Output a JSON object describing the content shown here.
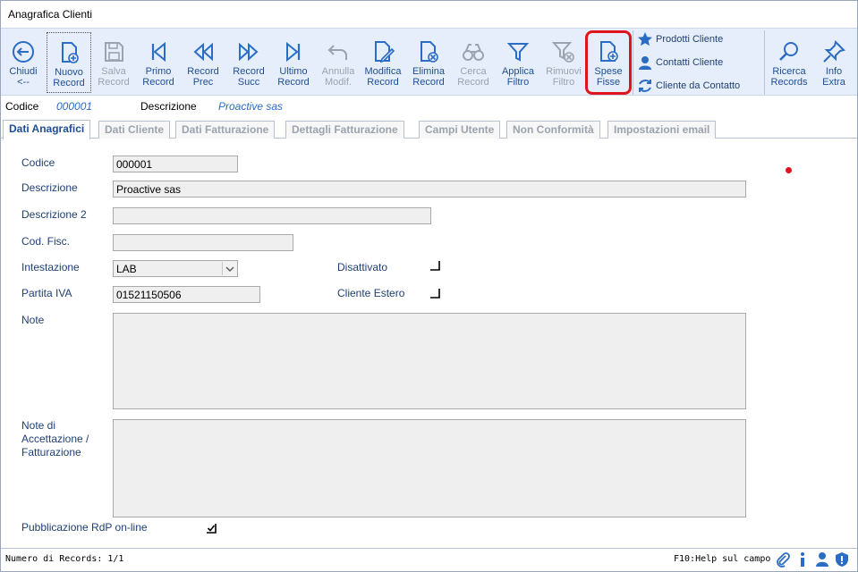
{
  "window": {
    "title": "Anagrafica Clienti"
  },
  "toolbar": {
    "buttons": [
      {
        "id": "chiudi",
        "label": "Chiudi\n<--",
        "icon": "back-arrow-icon",
        "enabled": true
      },
      {
        "id": "nuovo",
        "label": "Nuovo\nRecord",
        "icon": "new-document-icon",
        "enabled": true
      },
      {
        "id": "salva",
        "label": "Salva\nRecord",
        "icon": "floppy-icon",
        "enabled": false
      },
      {
        "id": "primo",
        "label": "Primo\nRecord",
        "icon": "first-record-icon",
        "enabled": true
      },
      {
        "id": "prec",
        "label": "Record\nPrec",
        "icon": "previous-record-icon",
        "enabled": true
      },
      {
        "id": "succ",
        "label": "Record\nSucc",
        "icon": "next-record-icon",
        "enabled": true
      },
      {
        "id": "ultimo",
        "label": "Ultimo\nRecord",
        "icon": "last-record-icon",
        "enabled": true
      },
      {
        "id": "annulla",
        "label": "Annulla\nModif.",
        "icon": "undo-icon",
        "enabled": false
      },
      {
        "id": "modifica",
        "label": "Modifica\nRecord",
        "icon": "edit-document-icon",
        "enabled": true
      },
      {
        "id": "elimina",
        "label": "Elimina\nRecord",
        "icon": "delete-document-icon",
        "enabled": true
      },
      {
        "id": "cerca",
        "label": "Cerca\nRecord",
        "icon": "binoculars-icon",
        "enabled": false
      },
      {
        "id": "applica",
        "label": "Applica\nFiltro",
        "icon": "filter-icon",
        "enabled": true
      },
      {
        "id": "rimuovi",
        "label": "Rimuovi\nFiltro",
        "icon": "remove-filter-icon",
        "enabled": false
      },
      {
        "id": "spese",
        "label": "Spese\nFisse",
        "icon": "add-document-icon",
        "enabled": true
      }
    ],
    "side_links": [
      {
        "label": "Prodotti Cliente",
        "icon": "star-icon"
      },
      {
        "label": "Contatti Cliente",
        "icon": "contact-person-icon"
      },
      {
        "label": "Cliente da Contatto",
        "icon": "refresh-icon"
      }
    ],
    "right_buttons": [
      {
        "id": "ricerca",
        "label": "Ricerca\nRecords",
        "icon": "magnifier-icon"
      },
      {
        "id": "info",
        "label": "Info\nExtra",
        "icon": "pin-icon"
      }
    ]
  },
  "infobar": {
    "codice_label": "Codice",
    "codice_value": "000001",
    "descrizione_label": "Descrizione",
    "descrizione_value": "Proactive sas"
  },
  "tabs": [
    {
      "label": "Dati Anagrafici",
      "active": true
    },
    {
      "label": "Dati Cliente",
      "active": false
    },
    {
      "label": "Dati Fatturazione",
      "active": false
    },
    {
      "label": "Dettagli Fatturazione",
      "active": false
    },
    {
      "label": "Campi Utente",
      "active": false
    },
    {
      "label": "Non Conformità",
      "active": false
    },
    {
      "label": "Impostazioni email",
      "active": false
    }
  ],
  "form": {
    "codice": {
      "label": "Codice",
      "value": "000001"
    },
    "descrizione": {
      "label": "Descrizione",
      "value": "Proactive sas"
    },
    "descrizione2": {
      "label": "Descrizione 2",
      "value": ""
    },
    "codfisc": {
      "label": "Cod. Fisc.",
      "value": ""
    },
    "intestazione": {
      "label": "Intestazione",
      "value": "LAB"
    },
    "partita_iva": {
      "label": "Partita IVA",
      "value": "01521150506"
    },
    "note": {
      "label": "Note",
      "value": ""
    },
    "note_acc": {
      "label": "Note di\nAccettazione /\nFatturazione",
      "value": ""
    },
    "disattivato": {
      "label": "Disattivato",
      "checked": false
    },
    "cliente_estero": {
      "label": "Cliente Estero",
      "checked": false
    },
    "pubblicazione": {
      "label": "Pubblicazione RdP on-line",
      "checked": true
    }
  },
  "status": {
    "records": "Numero di Records: 1/1",
    "help": "F10:Help sul campo"
  },
  "colors": {
    "accent": "#1f4e94",
    "highlight": "#e0141c",
    "toolbar_bg": "#e6eefb"
  }
}
